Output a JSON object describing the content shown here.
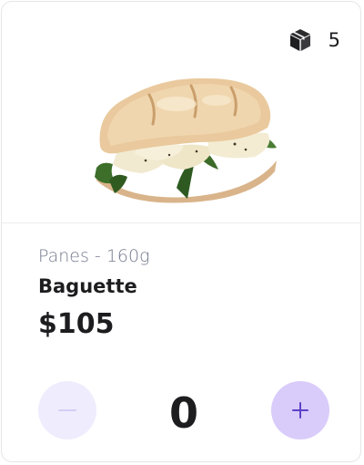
{
  "product": {
    "category": "Panes - 160g",
    "name": "Baguette",
    "price": "$105",
    "stock": "5",
    "quantity": "0"
  },
  "icons": {
    "stock": "package-icon",
    "decrement": "minus-icon",
    "increment": "plus-icon",
    "image": "sandwich-image"
  },
  "colors": {
    "decrement_bg": "#efecfd",
    "increment_bg": "#d9ccfb",
    "accent": "#6b4fd6"
  }
}
